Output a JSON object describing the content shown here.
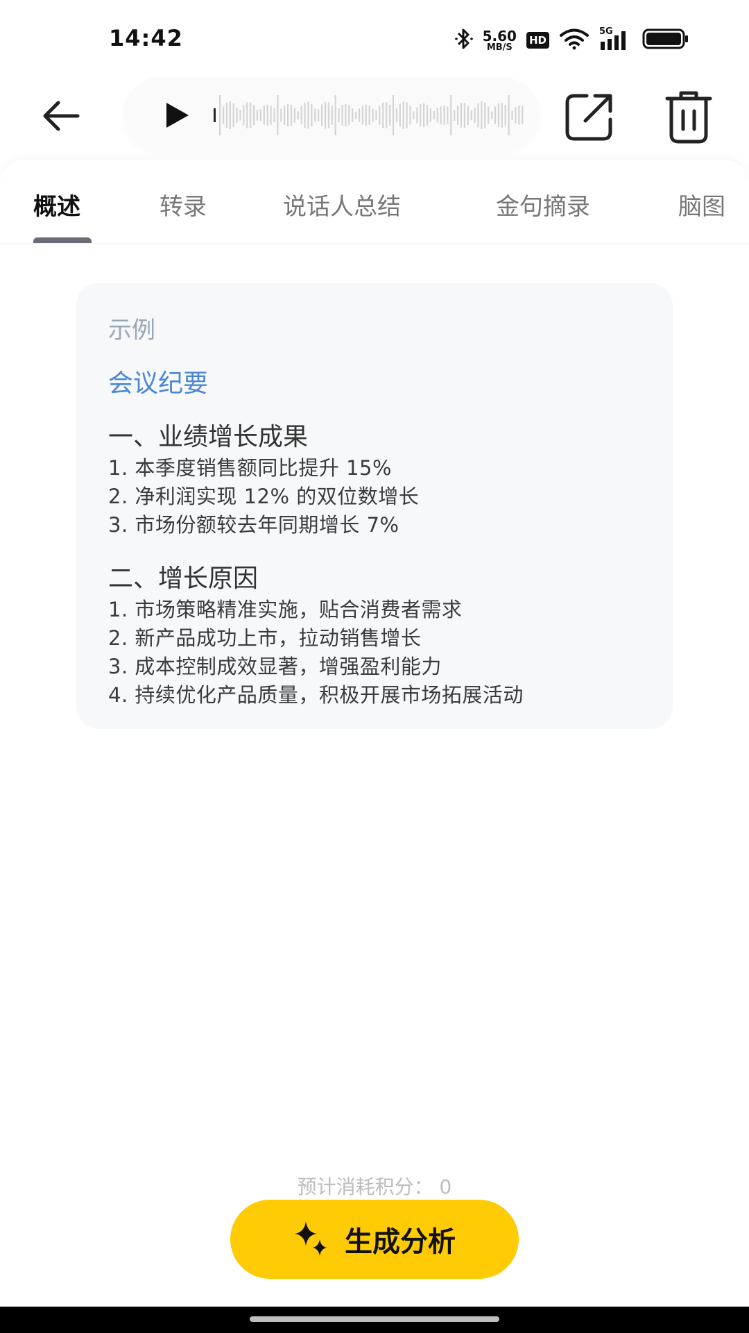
{
  "status_bar": {
    "time": "14:42",
    "speed_value": "5.60",
    "speed_unit": "MB/S",
    "hd": "HD",
    "network": "5G"
  },
  "tabs": [
    {
      "label": "概述",
      "active": true
    },
    {
      "label": "转录",
      "active": false
    },
    {
      "label": "说话人总结",
      "active": false
    },
    {
      "label": "金句摘录",
      "active": false
    },
    {
      "label": "脑图",
      "active": false
    }
  ],
  "example_card": {
    "label": "示例",
    "title": "会议纪要",
    "sections": [
      {
        "heading": "一、业绩增长成果",
        "items": [
          "1. 本季度销售额同比提升 15%",
          "2. 净利润实现 12% 的双位数增长",
          "3. 市场份额较去年同期增长 7%"
        ]
      },
      {
        "heading": "二、增长原因",
        "items": [
          "1. 市场策略精准实施，贴合消费者需求",
          "2. 新产品成功上市，拉动销售增长",
          "3. 成本控制成效显著，增强盈利能力",
          "4. 持续优化产品质量，积极开展市场拓展活动"
        ]
      }
    ]
  },
  "footer": {
    "cost_text": "预计消耗积分： 0",
    "generate_label": "生成分析"
  },
  "icons": {
    "back": "arrow-left-icon",
    "play": "play-icon",
    "share": "share-icon",
    "trash": "trash-icon",
    "sparkle": "sparkle-icon"
  },
  "colors": {
    "accent": "#ffcb05",
    "title_blue": "#4a86d4",
    "muted": "#9aa7b6"
  }
}
